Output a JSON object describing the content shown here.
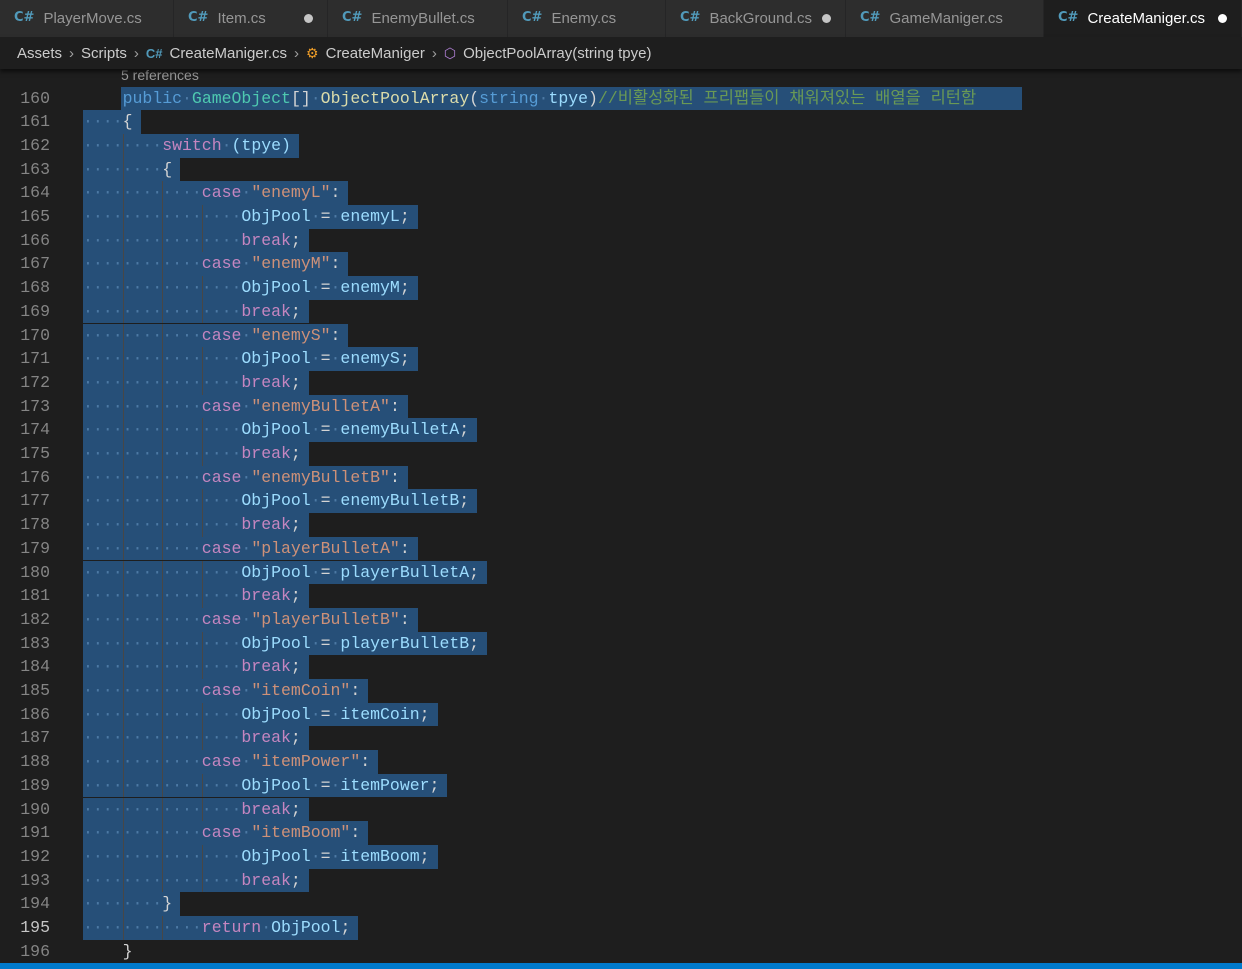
{
  "tabs": [
    {
      "label": "PlayerMove.cs",
      "active": false,
      "modified": false
    },
    {
      "label": "Item.cs",
      "active": false,
      "modified": true
    },
    {
      "label": "EnemyBullet.cs",
      "active": false,
      "modified": false
    },
    {
      "label": "Enemy.cs",
      "active": false,
      "modified": false
    },
    {
      "label": "BackGround.cs",
      "active": false,
      "modified": true
    },
    {
      "label": "GameManiger.cs",
      "active": false,
      "modified": false
    },
    {
      "label": "CreateManiger.cs",
      "active": true,
      "modified": true
    }
  ],
  "breadcrumb": {
    "assets": "Assets",
    "scripts": "Scripts",
    "file": "CreateManiger.cs",
    "class": "CreateManiger",
    "method": "ObjectPoolArray(string tpye)"
  },
  "codelens": "5 references",
  "colors": {
    "editor_bg": "#1e1e1e",
    "selection": "#264f78",
    "keyword": "#569cd6",
    "control": "#c586c0",
    "string": "#ce9178",
    "type": "#4ec9b0",
    "variable": "#9cdcfe",
    "function": "#dcdcaa",
    "comment": "#6a9955",
    "statusbar": "#007acc"
  },
  "current_line": "195",
  "lines": [
    {
      "n": "160",
      "indent": 1,
      "tokens": [
        [
          "public",
          "kw"
        ],
        [
          " ",
          "w"
        ],
        [
          "GameObject",
          "typ"
        ],
        [
          "[]",
          "pun"
        ],
        [
          " ",
          "w"
        ],
        [
          "ObjectPoolArray",
          "fn"
        ],
        [
          "(",
          "pun"
        ],
        [
          "string",
          "kw"
        ],
        [
          " ",
          "w"
        ],
        [
          "tpye",
          "var"
        ],
        [
          ")",
          "pun"
        ],
        [
          "//비활성화된 프리팹들이 채워져있는 배열을 리턴함",
          "cmt"
        ]
      ]
    },
    {
      "n": "161",
      "indent": 1,
      "tokens": [
        [
          "{",
          "pun"
        ]
      ]
    },
    {
      "n": "162",
      "indent": 2,
      "tokens": [
        [
          "switch",
          "ctl"
        ],
        [
          " ",
          "w"
        ],
        [
          "(tpye)",
          "var"
        ]
      ]
    },
    {
      "n": "163",
      "indent": 2,
      "tokens": [
        [
          "{",
          "pun"
        ]
      ]
    },
    {
      "n": "164",
      "indent": 3,
      "tokens": [
        [
          "case",
          "ctl"
        ],
        [
          " ",
          "w"
        ],
        [
          "\"enemyL\"",
          "str"
        ],
        [
          ":",
          "pun"
        ]
      ]
    },
    {
      "n": "165",
      "indent": 4,
      "tokens": [
        [
          "ObjPool",
          "var"
        ],
        [
          " ",
          "w"
        ],
        [
          "=",
          "pun"
        ],
        [
          " ",
          "w"
        ],
        [
          "enemyL",
          "var"
        ],
        [
          ";",
          "pun"
        ]
      ]
    },
    {
      "n": "166",
      "indent": 4,
      "tokens": [
        [
          "break",
          "ctl"
        ],
        [
          ";",
          "pun"
        ]
      ]
    },
    {
      "n": "167",
      "indent": 3,
      "tokens": [
        [
          "case",
          "ctl"
        ],
        [
          " ",
          "w"
        ],
        [
          "\"enemyM\"",
          "str"
        ],
        [
          ":",
          "pun"
        ]
      ]
    },
    {
      "n": "168",
      "indent": 4,
      "tokens": [
        [
          "ObjPool",
          "var"
        ],
        [
          " ",
          "w"
        ],
        [
          "=",
          "pun"
        ],
        [
          " ",
          "w"
        ],
        [
          "enemyM",
          "var"
        ],
        [
          ";",
          "pun"
        ]
      ]
    },
    {
      "n": "169",
      "indent": 4,
      "tokens": [
        [
          "break",
          "ctl"
        ],
        [
          ";",
          "pun"
        ]
      ]
    },
    {
      "n": "170",
      "indent": 3,
      "tokens": [
        [
          "case",
          "ctl"
        ],
        [
          " ",
          "w"
        ],
        [
          "\"enemyS\"",
          "str"
        ],
        [
          ":",
          "pun"
        ]
      ]
    },
    {
      "n": "171",
      "indent": 4,
      "tokens": [
        [
          "ObjPool",
          "var"
        ],
        [
          " ",
          "w"
        ],
        [
          "=",
          "pun"
        ],
        [
          " ",
          "w"
        ],
        [
          "enemyS",
          "var"
        ],
        [
          ";",
          "pun"
        ]
      ]
    },
    {
      "n": "172",
      "indent": 4,
      "tokens": [
        [
          "break",
          "ctl"
        ],
        [
          ";",
          "pun"
        ]
      ]
    },
    {
      "n": "173",
      "indent": 3,
      "tokens": [
        [
          "case",
          "ctl"
        ],
        [
          " ",
          "w"
        ],
        [
          "\"enemyBulletA\"",
          "str"
        ],
        [
          ":",
          "pun"
        ]
      ]
    },
    {
      "n": "174",
      "indent": 4,
      "tokens": [
        [
          "ObjPool",
          "var"
        ],
        [
          " ",
          "w"
        ],
        [
          "=",
          "pun"
        ],
        [
          " ",
          "w"
        ],
        [
          "enemyBulletA",
          "var"
        ],
        [
          ";",
          "pun"
        ]
      ]
    },
    {
      "n": "175",
      "indent": 4,
      "tokens": [
        [
          "break",
          "ctl"
        ],
        [
          ";",
          "pun"
        ]
      ]
    },
    {
      "n": "176",
      "indent": 3,
      "tokens": [
        [
          "case",
          "ctl"
        ],
        [
          " ",
          "w"
        ],
        [
          "\"enemyBulletB\"",
          "str"
        ],
        [
          ":",
          "pun"
        ]
      ]
    },
    {
      "n": "177",
      "indent": 4,
      "tokens": [
        [
          "ObjPool",
          "var"
        ],
        [
          " ",
          "w"
        ],
        [
          "=",
          "pun"
        ],
        [
          " ",
          "w"
        ],
        [
          "enemyBulletB",
          "var"
        ],
        [
          ";",
          "pun"
        ]
      ]
    },
    {
      "n": "178",
      "indent": 4,
      "tokens": [
        [
          "break",
          "ctl"
        ],
        [
          ";",
          "pun"
        ]
      ]
    },
    {
      "n": "179",
      "indent": 3,
      "tokens": [
        [
          "case",
          "ctl"
        ],
        [
          " ",
          "w"
        ],
        [
          "\"playerBulletA\"",
          "str"
        ],
        [
          ":",
          "pun"
        ]
      ]
    },
    {
      "n": "180",
      "indent": 4,
      "tokens": [
        [
          "ObjPool",
          "var"
        ],
        [
          " ",
          "w"
        ],
        [
          "=",
          "pun"
        ],
        [
          " ",
          "w"
        ],
        [
          "playerBulletA",
          "var"
        ],
        [
          ";",
          "pun"
        ]
      ]
    },
    {
      "n": "181",
      "indent": 4,
      "tokens": [
        [
          "break",
          "ctl"
        ],
        [
          ";",
          "pun"
        ]
      ]
    },
    {
      "n": "182",
      "indent": 3,
      "tokens": [
        [
          "case",
          "ctl"
        ],
        [
          " ",
          "w"
        ],
        [
          "\"playerBulletB\"",
          "str"
        ],
        [
          ":",
          "pun"
        ]
      ]
    },
    {
      "n": "183",
      "indent": 4,
      "tokens": [
        [
          "ObjPool",
          "var"
        ],
        [
          " ",
          "w"
        ],
        [
          "=",
          "pun"
        ],
        [
          " ",
          "w"
        ],
        [
          "playerBulletB",
          "var"
        ],
        [
          ";",
          "pun"
        ]
      ]
    },
    {
      "n": "184",
      "indent": 4,
      "tokens": [
        [
          "break",
          "ctl"
        ],
        [
          ";",
          "pun"
        ]
      ]
    },
    {
      "n": "185",
      "indent": 3,
      "tokens": [
        [
          "case",
          "ctl"
        ],
        [
          " ",
          "w"
        ],
        [
          "\"itemCoin\"",
          "str"
        ],
        [
          ":",
          "pun"
        ]
      ]
    },
    {
      "n": "186",
      "indent": 4,
      "tokens": [
        [
          "ObjPool",
          "var"
        ],
        [
          " ",
          "w"
        ],
        [
          "=",
          "pun"
        ],
        [
          " ",
          "w"
        ],
        [
          "itemCoin",
          "var"
        ],
        [
          ";",
          "pun"
        ]
      ]
    },
    {
      "n": "187",
      "indent": 4,
      "tokens": [
        [
          "break",
          "ctl"
        ],
        [
          ";",
          "pun"
        ]
      ]
    },
    {
      "n": "188",
      "indent": 3,
      "tokens": [
        [
          "case",
          "ctl"
        ],
        [
          " ",
          "w"
        ],
        [
          "\"itemPower\"",
          "str"
        ],
        [
          ":",
          "pun"
        ]
      ]
    },
    {
      "n": "189",
      "indent": 4,
      "tokens": [
        [
          "ObjPool",
          "var"
        ],
        [
          " ",
          "w"
        ],
        [
          "=",
          "pun"
        ],
        [
          " ",
          "w"
        ],
        [
          "itemPower",
          "var"
        ],
        [
          ";",
          "pun"
        ]
      ]
    },
    {
      "n": "190",
      "indent": 4,
      "tokens": [
        [
          "break",
          "ctl"
        ],
        [
          ";",
          "pun"
        ]
      ]
    },
    {
      "n": "191",
      "indent": 3,
      "tokens": [
        [
          "case",
          "ctl"
        ],
        [
          " ",
          "w"
        ],
        [
          "\"itemBoom\"",
          "str"
        ],
        [
          ":",
          "pun"
        ]
      ]
    },
    {
      "n": "192",
      "indent": 4,
      "tokens": [
        [
          "ObjPool",
          "var"
        ],
        [
          " ",
          "w"
        ],
        [
          "=",
          "pun"
        ],
        [
          " ",
          "w"
        ],
        [
          "itemBoom",
          "var"
        ],
        [
          ";",
          "pun"
        ]
      ]
    },
    {
      "n": "193",
      "indent": 4,
      "tokens": [
        [
          "break",
          "ctl"
        ],
        [
          ";",
          "pun"
        ]
      ]
    },
    {
      "n": "194",
      "indent": 2,
      "tokens": [
        [
          "}",
          "pun"
        ]
      ]
    },
    {
      "n": "195",
      "indent": 3,
      "tokens": [
        [
          "return",
          "ctl"
        ],
        [
          " ",
          "w"
        ],
        [
          "ObjPool",
          "var"
        ],
        [
          ";",
          "pun"
        ]
      ]
    },
    {
      "n": "196",
      "indent": 1,
      "tokens": [
        [
          "}",
          "pun"
        ]
      ]
    }
  ]
}
